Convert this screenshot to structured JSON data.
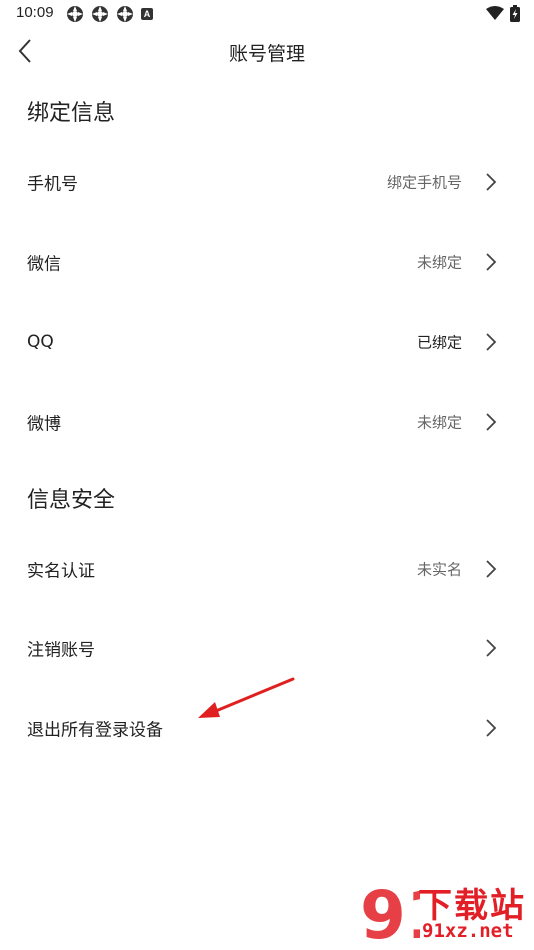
{
  "status_bar": {
    "time": "10:09",
    "notification_icons": [
      "app-icon",
      "app-icon",
      "app-icon",
      "a-badge-icon"
    ],
    "a_badge": "A"
  },
  "header": {
    "title": "账号管理",
    "back_icon": "chevron-left-icon"
  },
  "sections": {
    "binding": {
      "title": "绑定信息",
      "rows": [
        {
          "label": "手机号",
          "value": "绑定手机号"
        },
        {
          "label": "微信",
          "value": "未绑定"
        },
        {
          "label": "QQ",
          "value": "已绑定"
        },
        {
          "label": "微博",
          "value": "未绑定"
        }
      ]
    },
    "security": {
      "title": "信息安全",
      "rows": [
        {
          "label": "实名认证",
          "value": "未实名"
        },
        {
          "label": "注销账号",
          "value": ""
        },
        {
          "label": "退出所有登录设备",
          "value": ""
        }
      ]
    }
  },
  "colors": {
    "accent_arrow": "#e02020",
    "watermark": "#e21e26"
  },
  "watermark": {
    "line1": "下载站",
    "line2": "91xz.net",
    "logo_digits": "91"
  }
}
